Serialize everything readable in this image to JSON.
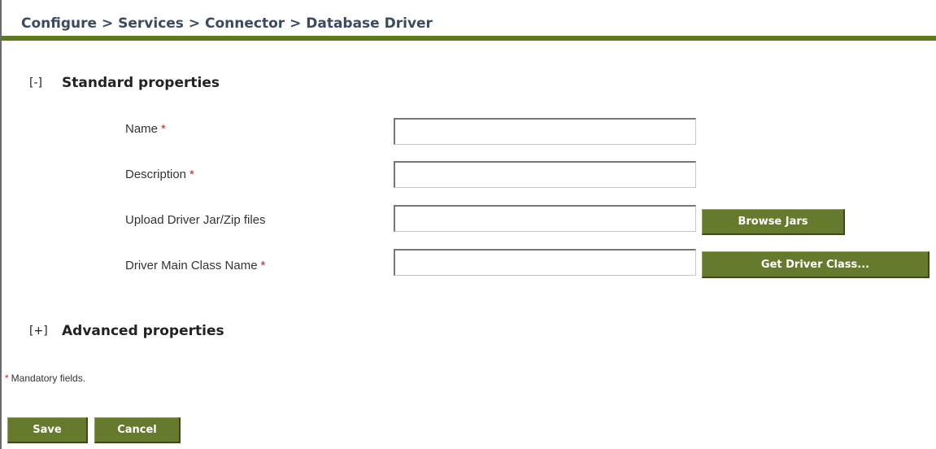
{
  "breadcrumb": {
    "text": "Configure > Services > Connector > Database Driver"
  },
  "standard_section": {
    "toggle": "[-]",
    "title": "Standard properties"
  },
  "fields": [
    {
      "label": "Name",
      "required_marker": "*",
      "value": ""
    },
    {
      "label": "Description",
      "required_marker": "*",
      "value": ""
    },
    {
      "label": "Upload Driver Jar/Zip files",
      "required_marker": "",
      "value": ""
    },
    {
      "label": "Driver Main Class Name",
      "required_marker": "*",
      "value": ""
    }
  ],
  "buttons": {
    "browse_jars": "Browse Jars",
    "get_driver_class": "Get Driver Class...",
    "save": "Save",
    "cancel": "Cancel"
  },
  "advanced_section": {
    "toggle": "[+]",
    "title": "Advanced properties"
  },
  "footer": {
    "mandatory_marker": "*",
    "mandatory_note": "Mandatory fields."
  },
  "colors": {
    "accent": "#5b7a1f",
    "button": "#667a2e",
    "required": "#cc2222",
    "breadcrumb_text": "#3b4a5e"
  }
}
